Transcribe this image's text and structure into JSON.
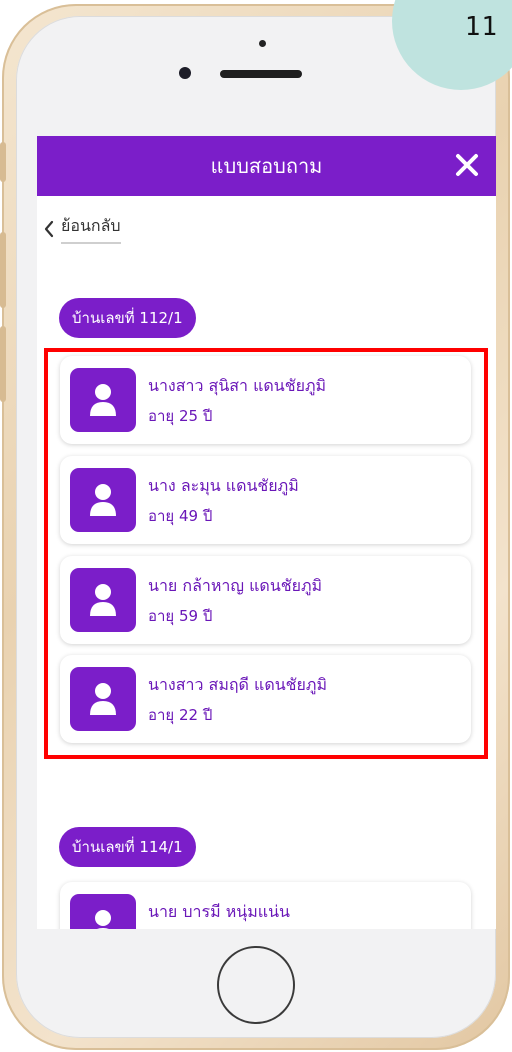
{
  "step_badge": {
    "number": "11",
    "color": "#bfe3df"
  },
  "header": {
    "title": "แบบสอบถาม",
    "close_icon": "close-icon",
    "color": "#7b1ec9"
  },
  "back": {
    "label": "ย้อนกลับ",
    "icon": "chevron-left-icon"
  },
  "households": [
    {
      "label": "บ้านเลขที่ 112/1",
      "members": [
        {
          "name": "นางสาว สุนิสา แดนชัยภูมิ",
          "age": "อายุ 25 ปี"
        },
        {
          "name": "นาง ละมุน แดนชัยภูมิ",
          "age": "อายุ 49 ปี"
        },
        {
          "name": "นาย กล้าหาญ แดนชัยภูมิ",
          "age": "อายุ 59 ปี"
        },
        {
          "name": "นางสาว สมฤดี แดนชัยภูมิ",
          "age": "อายุ 22 ปี"
        }
      ]
    },
    {
      "label": "บ้านเลขที่ 114/1",
      "members": [
        {
          "name": "นาย บารมี หนุ่มแน่น",
          "age": ""
        }
      ]
    }
  ],
  "highlight_color": "#ff0000"
}
